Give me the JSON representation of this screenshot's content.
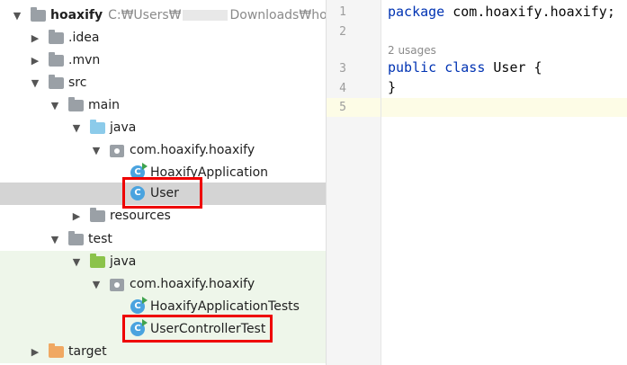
{
  "project": {
    "name": "hoaxify",
    "path_prefix": "C:₩Users₩",
    "path_suffix": "Downloads₩hoaxify"
  },
  "tree": {
    "idea": ".idea",
    "mvn": ".mvn",
    "src": "src",
    "main": "main",
    "main_java": "java",
    "main_pkg": "com.hoaxify.hoaxify",
    "app_class": "HoaxifyApplication",
    "user_class": "User",
    "resources": "resources",
    "test": "test",
    "test_java": "java",
    "test_pkg": "com.hoaxify.hoaxify",
    "app_tests": "HoaxifyApplicationTests",
    "user_controller_test": "UserControllerTest",
    "target": "target",
    "class_glyph": "C"
  },
  "editor": {
    "line_numbers": [
      "1",
      "2",
      "3",
      "4",
      "5"
    ],
    "kw_package": "package",
    "package_name": " com.hoaxify.hoaxify;",
    "usages": "2 usages",
    "kw_public": "public",
    "kw_class": "class",
    "class_decl": " User {",
    "closing": "}"
  },
  "colors": {
    "highlight_box": "#ee0000",
    "selected_row": "#d4d4d4",
    "test_background": "#eef6ea",
    "keyword": "#0033b3"
  }
}
